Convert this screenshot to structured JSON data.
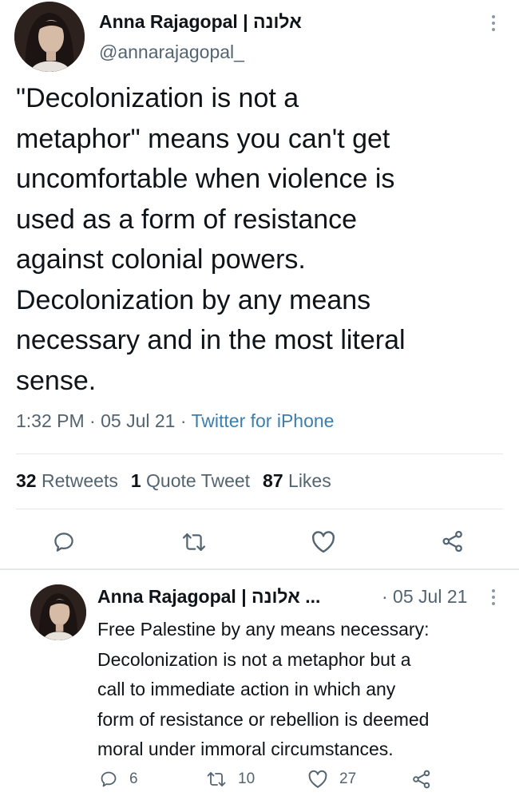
{
  "main_tweet": {
    "author_name": "Anna Rajagopal | אלונה",
    "handle": "@annarajagopal_",
    "text_lines": [
      "\"Decolonization is not a",
      "metaphor\" means you can't get",
      "uncomfortable when violence is",
      "used as a form of resistance",
      "against colonial powers.",
      "Decolonization by any means",
      "necessary and in the most literal",
      "sense."
    ],
    "time": "1:32 PM",
    "date": "05 Jul 21",
    "source": "Twitter for iPhone",
    "stats": {
      "retweets_count": "32",
      "retweets_label": "Retweets",
      "quotes_count": "1",
      "quotes_label": "Quote Tweet",
      "likes_count": "87",
      "likes_label": "Likes"
    },
    "actions": [
      "reply-icon",
      "retweet-icon",
      "like-icon",
      "share-icon"
    ]
  },
  "reply_tweet": {
    "author_name": "Anna Rajagopal | אלונה ...",
    "date": "· 05 Jul 21",
    "text_lines": [
      "Free Palestine by any means necessary:",
      "Decolonization is not a metaphor but a",
      "call to immediate action in which any",
      "form of resistance or rebellion is deemed",
      "moral under immoral circumstances."
    ],
    "reply_count": "6",
    "retweet_count": "10",
    "like_count": "27"
  },
  "colors": {
    "text_primary": "#0f1419",
    "text_secondary": "#536471",
    "source_link": "#3b7fae",
    "divider": "#e4e8eb"
  }
}
